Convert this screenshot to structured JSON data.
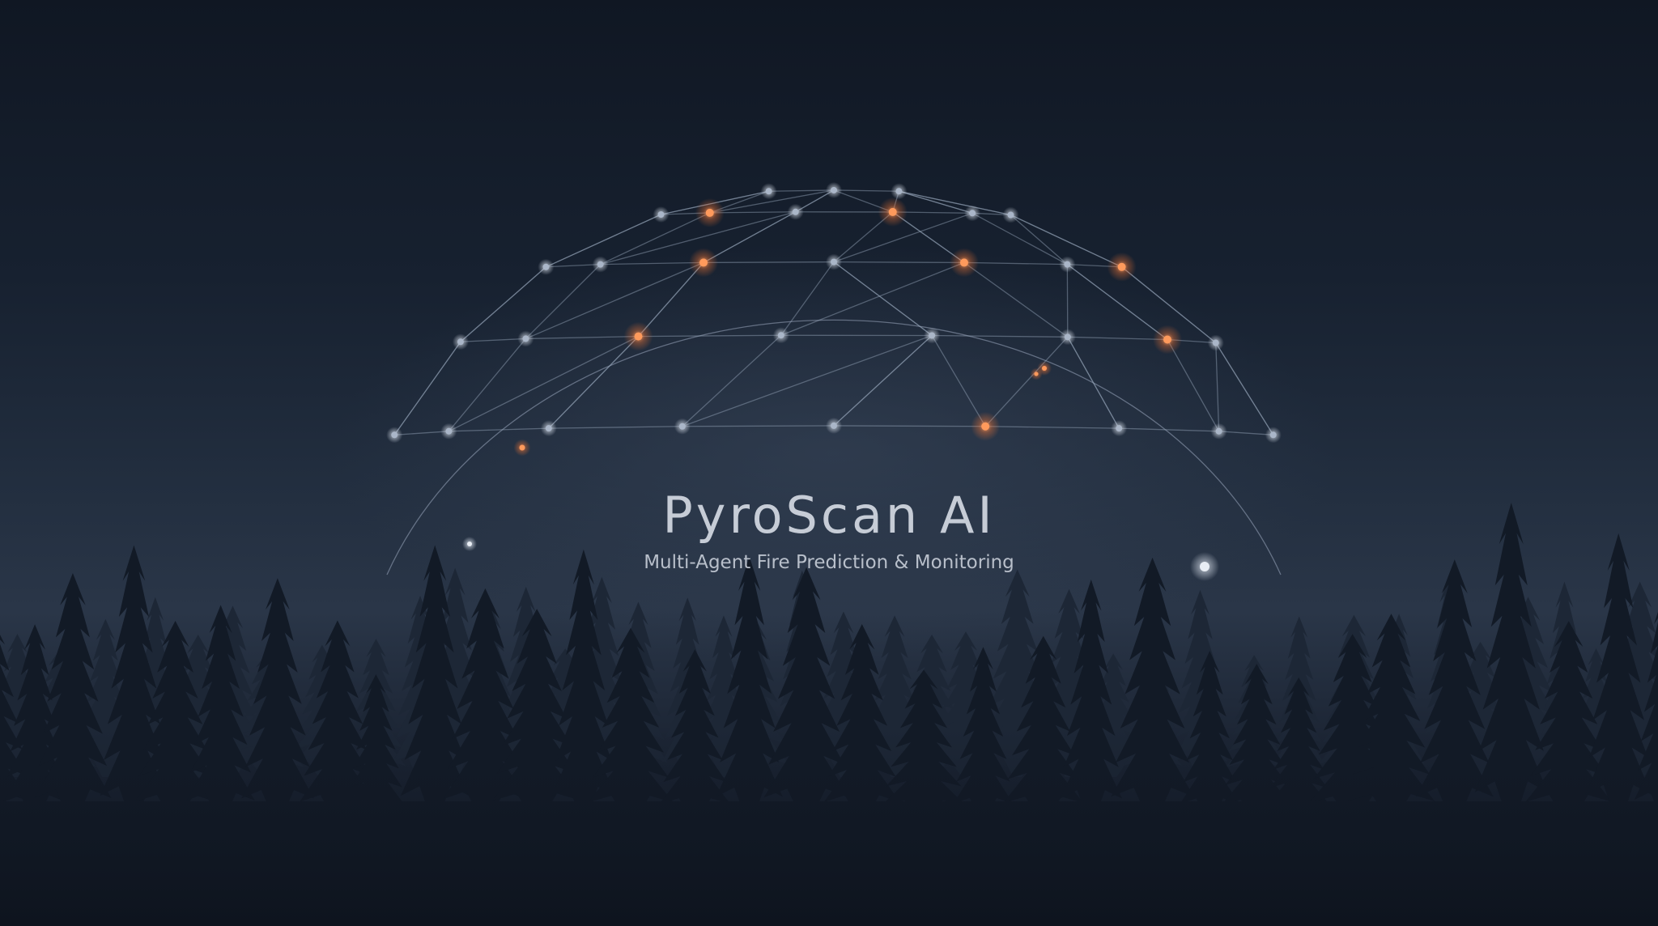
{
  "title": "PyroScan AI",
  "subtitle": "Multi-Agent Fire Prediction & Monitoring",
  "icons": [
    "network-dome-icon",
    "forest-silhouette"
  ],
  "colors": {
    "sky_top": "#101723",
    "sky_horizon": "#2a3648",
    "mesh_line": "#9aa8bd",
    "node_cool": "#aab6c8",
    "node_hot": "#ff9a5c",
    "tree": "#121a26",
    "title": "#c6ccd6"
  }
}
